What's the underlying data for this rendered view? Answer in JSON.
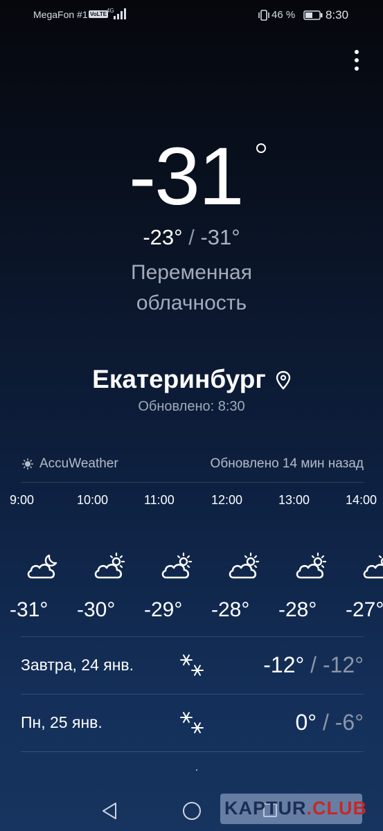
{
  "status_bar": {
    "carrier": "MegaFon #1",
    "volte": "VoLTE",
    "network": "4G",
    "battery_percent": "46 %",
    "time": "8:30"
  },
  "current": {
    "temperature": "-31",
    "high": "-23°",
    "separator": "/",
    "low": "-31°",
    "condition": "Переменная облачность"
  },
  "location": {
    "city": "Екатеринбург",
    "updated": "Обновлено: 8:30"
  },
  "provider": {
    "name": "AccuWeather",
    "updated": "Обновлено 14 мин назад"
  },
  "hourly": [
    {
      "time": "9:00",
      "icon": "partly-cloudy-night-icon",
      "temp": "-31°"
    },
    {
      "time": "10:00",
      "icon": "partly-cloudy-day-icon",
      "temp": "-30°"
    },
    {
      "time": "11:00",
      "icon": "partly-cloudy-day-icon",
      "temp": "-29°"
    },
    {
      "time": "12:00",
      "icon": "partly-cloudy-day-icon",
      "temp": "-28°"
    },
    {
      "time": "13:00",
      "icon": "partly-cloudy-day-icon",
      "temp": "-28°"
    },
    {
      "time": "14:00",
      "icon": "partly-cloudy-day-icon",
      "temp": "-27°"
    }
  ],
  "daily": [
    {
      "label": "Завтра, 24 янв.",
      "icon": "snow-icon",
      "high": "-12°",
      "separator": "/",
      "low": "-12°"
    },
    {
      "label": "Пн, 25 янв.",
      "icon": "snow-icon",
      "high": "0°",
      "separator": "/",
      "low": "-6°"
    }
  ],
  "watermark": {
    "text_main": "KAPTUR",
    "text_accent": ".CLUB"
  },
  "colors": {
    "background_top": "#05070c",
    "background_bottom": "#16345f",
    "secondary_text": "#a3acbb",
    "watermark_accent": "#c62828"
  }
}
